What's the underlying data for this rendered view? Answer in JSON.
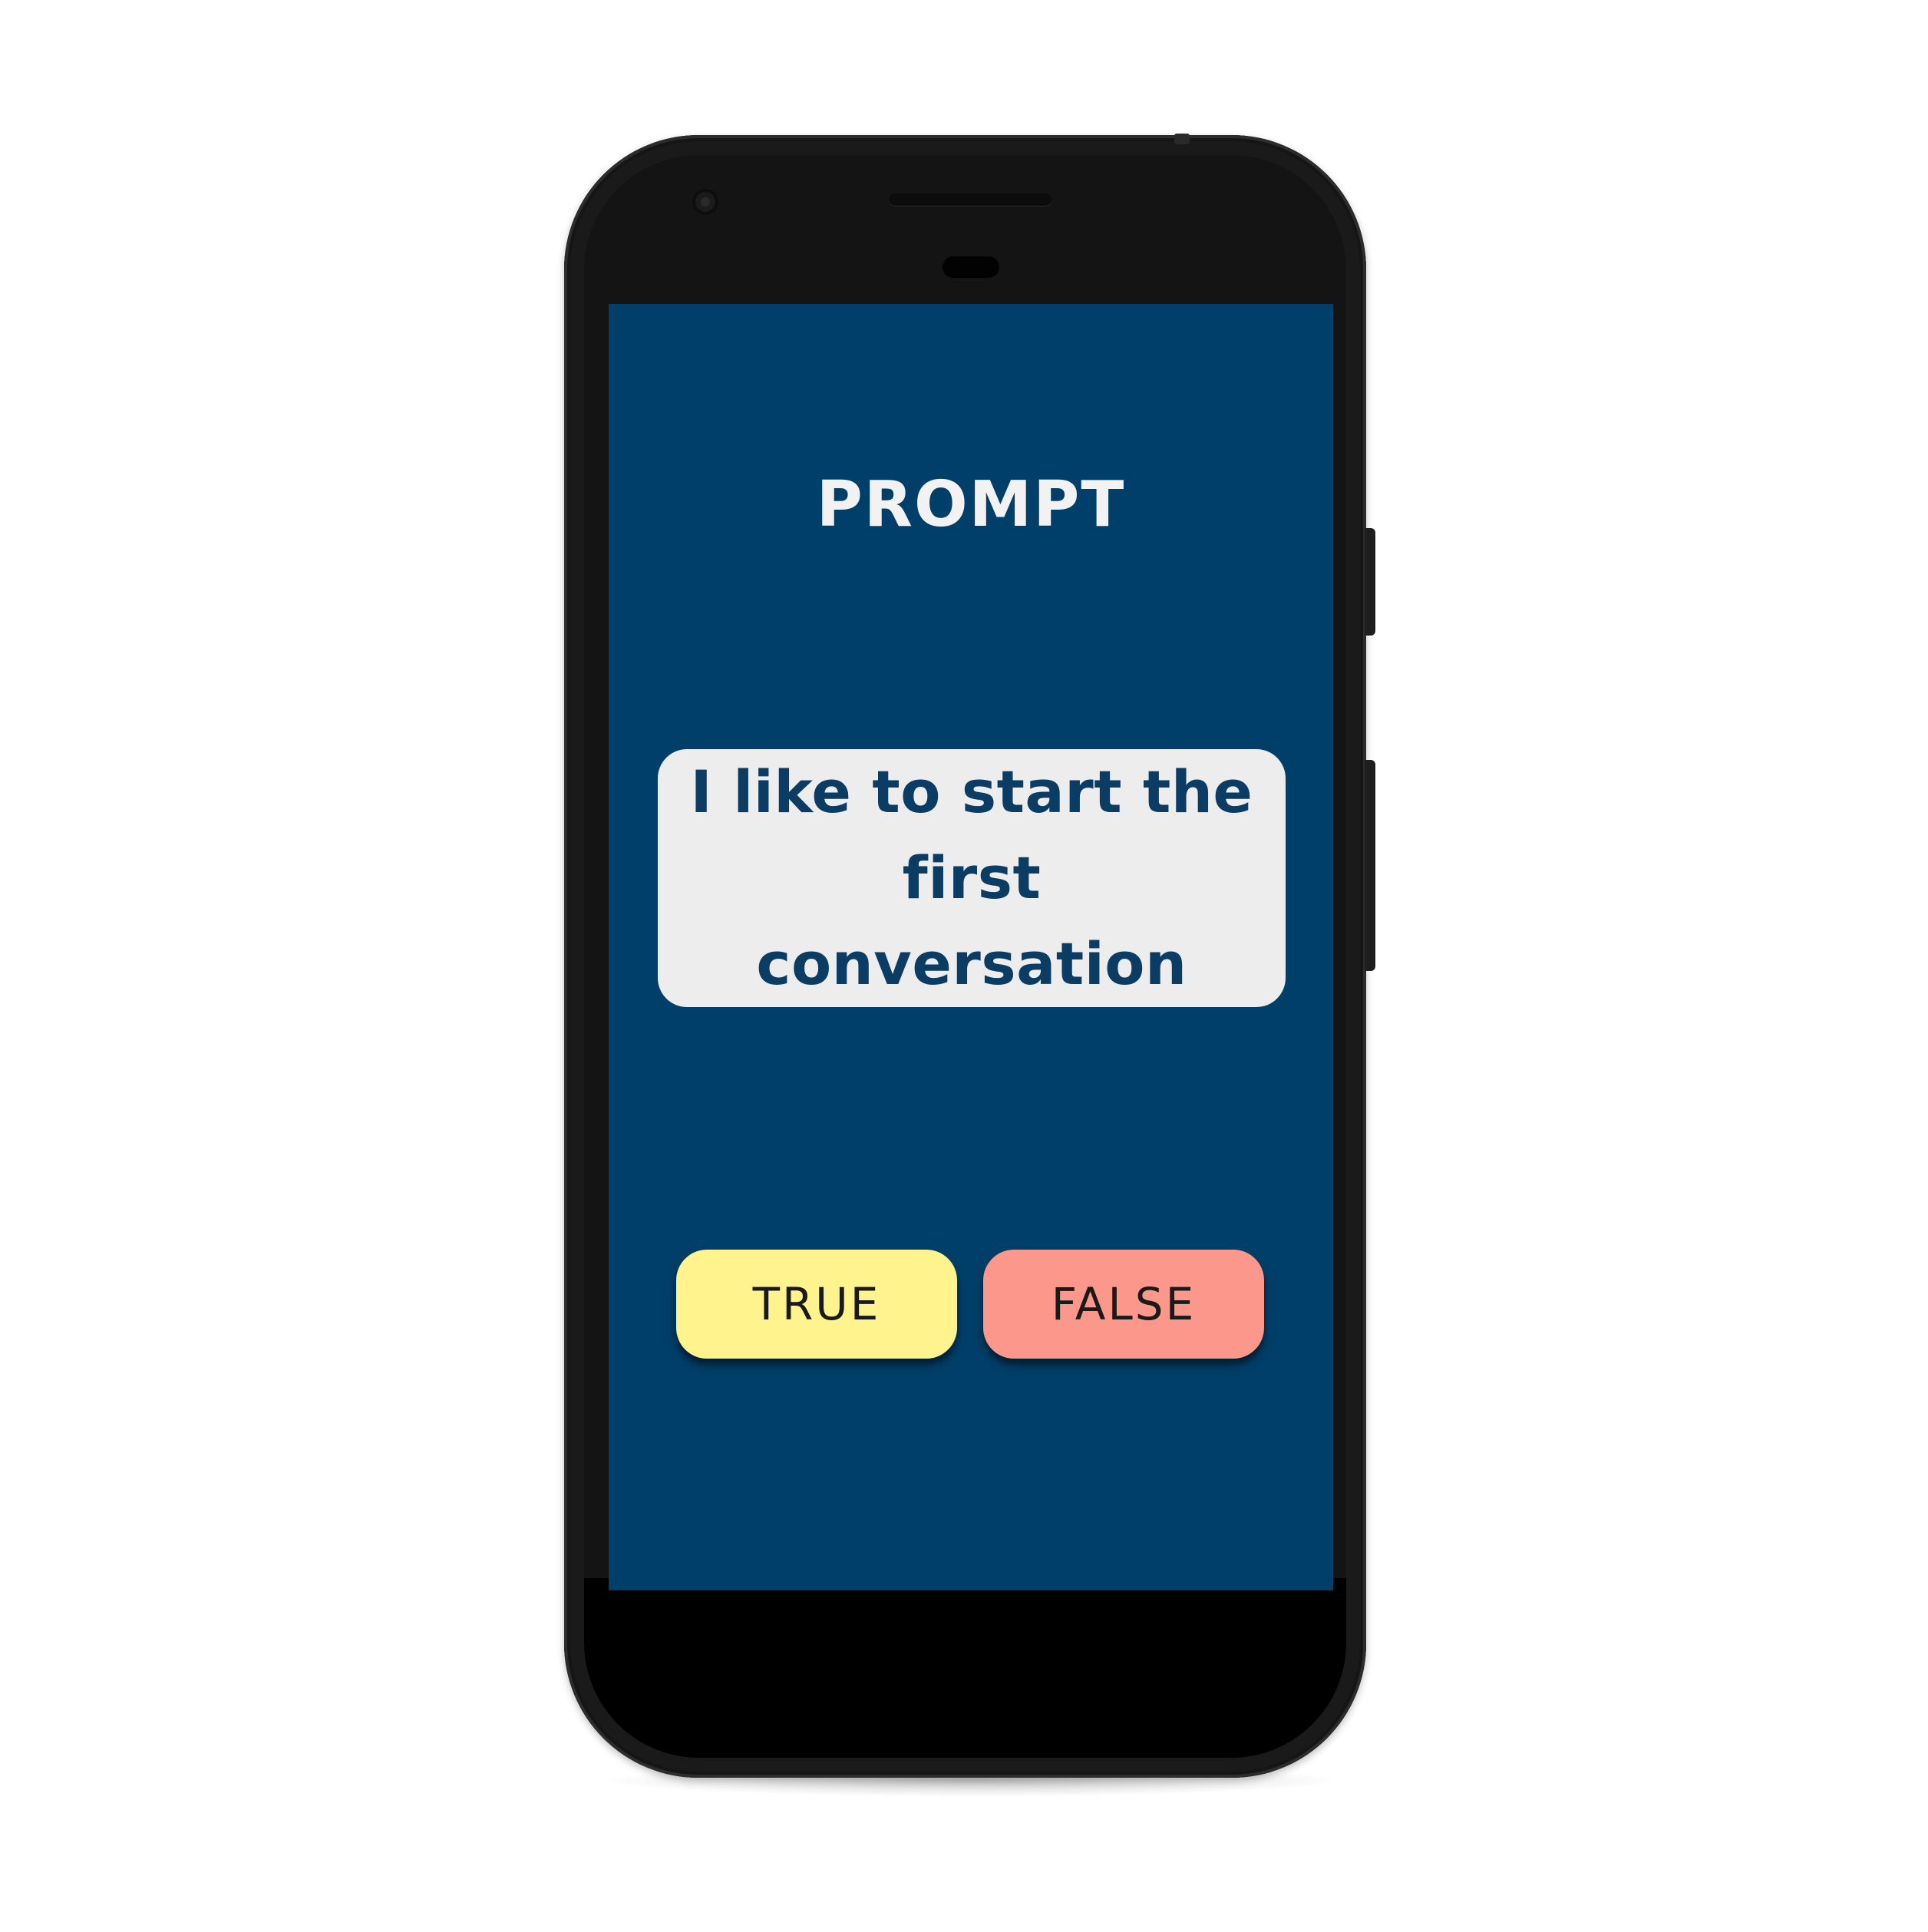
{
  "screen": {
    "title": "PROMPT",
    "prompt": "I like to start the first conversation",
    "background_color": "#003f69"
  },
  "answers": {
    "true_label": "TRUE",
    "false_label": "FALSE",
    "true_color": "#fef38c",
    "false_color": "#fc988b"
  },
  "device": {
    "type": "android-phone",
    "icons": [
      "front-camera-icon",
      "earpiece-speaker-icon",
      "proximity-sensor-icon"
    ]
  }
}
